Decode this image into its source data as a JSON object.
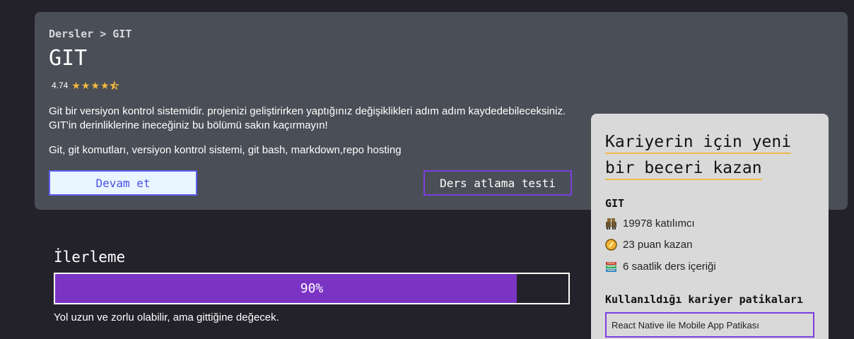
{
  "course": {
    "breadcrumb": "Dersler > GIT",
    "title": "GIT",
    "rating": "4.74",
    "rating_stars": 4.74,
    "description": "Git bir versiyon kontrol sistemidir. projenizi geliştirirken yaptığınız değişiklikleri adım adım kaydedebileceksiniz. GIT'in derinliklerine ineceğiniz bu bölümü sakın kaçırmayın!",
    "tags": "Git, git komutları, versiyon kontrol sistemi, git bash, markdown,repo hosting",
    "continue_label": "Devam et",
    "skip_test_label": "Ders atlama testi"
  },
  "progress": {
    "title": "İlerleme",
    "percent": 90,
    "percent_label": "90%",
    "note": "Yol uzun ve zorlu olabilir, ama gittiğine değecek."
  },
  "career": {
    "heading_line1": "Kariyerin için yeni",
    "heading_line2": "bir beceri kazan",
    "course_name": "GIT",
    "stats": {
      "participants": "19978 katılımcı",
      "points": "23 puan kazan",
      "content": "6 saatlik ders içeriği"
    },
    "paths_title": "Kullanıldığı kariyer patikaları",
    "paths": [
      "React Native ile Mobile App Patikası"
    ]
  },
  "colors": {
    "accent_purple": "#7b33c4",
    "star": "#f4b940",
    "underline": "#f0b94a"
  }
}
